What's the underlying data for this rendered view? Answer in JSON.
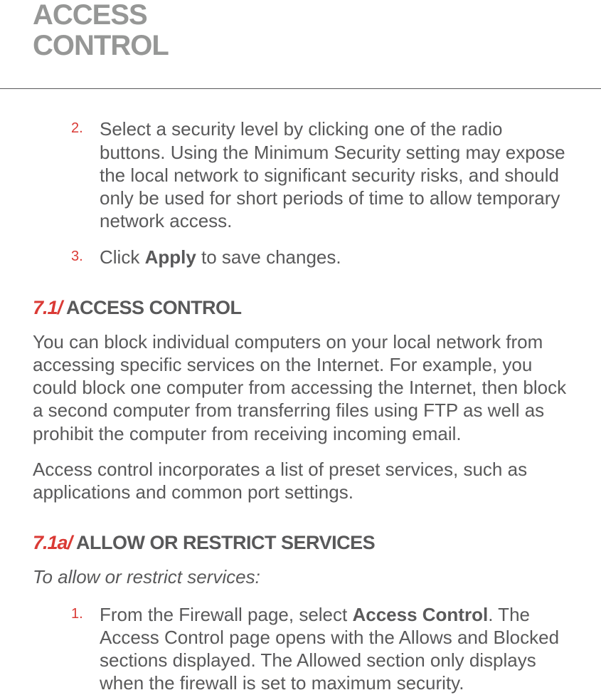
{
  "title_line1": "ACCESS",
  "title_line2": "CONTROL",
  "intro_list": [
    {
      "marker": "2.",
      "text_parts": [
        {
          "text": "Select a security level by clicking one of the radio buttons. Using the Minimum Security setting may expose the local network to significant security risks, and should only be used for short periods of time to allow temporary network access.",
          "bold": false
        }
      ]
    },
    {
      "marker": "3.",
      "text_parts": [
        {
          "text": "Click ",
          "bold": false
        },
        {
          "text": "Apply",
          "bold": true
        },
        {
          "text": " to save changes.",
          "bold": false
        }
      ]
    }
  ],
  "section71": {
    "number": "7.1/",
    "title": " ACCESS CONTROL",
    "para1": "You can block individual computers on your local network from accessing specific services on the Internet. For example, you could block one computer from accessing the Internet, then block a second computer from transferring files using FTP as well as prohibit the computer from receiving incoming email.",
    "para2": "Access control incorporates a list of preset services, such as applications and common port settings."
  },
  "section71a": {
    "number": "7.1a/",
    "title": " ALLOW OR RESTRICT SERVICES",
    "lead": "To allow or restrict services:",
    "list": [
      {
        "marker": "1.",
        "text_parts": [
          {
            "text": "From the Firewall page, select ",
            "bold": false
          },
          {
            "text": "Access Control",
            "bold": true
          },
          {
            "text": ". The Access Control page opens with the Allows and Blocked sections displayed. The Allowed section only displays when the firewall is set to maximum security.",
            "bold": false
          }
        ]
      }
    ]
  }
}
